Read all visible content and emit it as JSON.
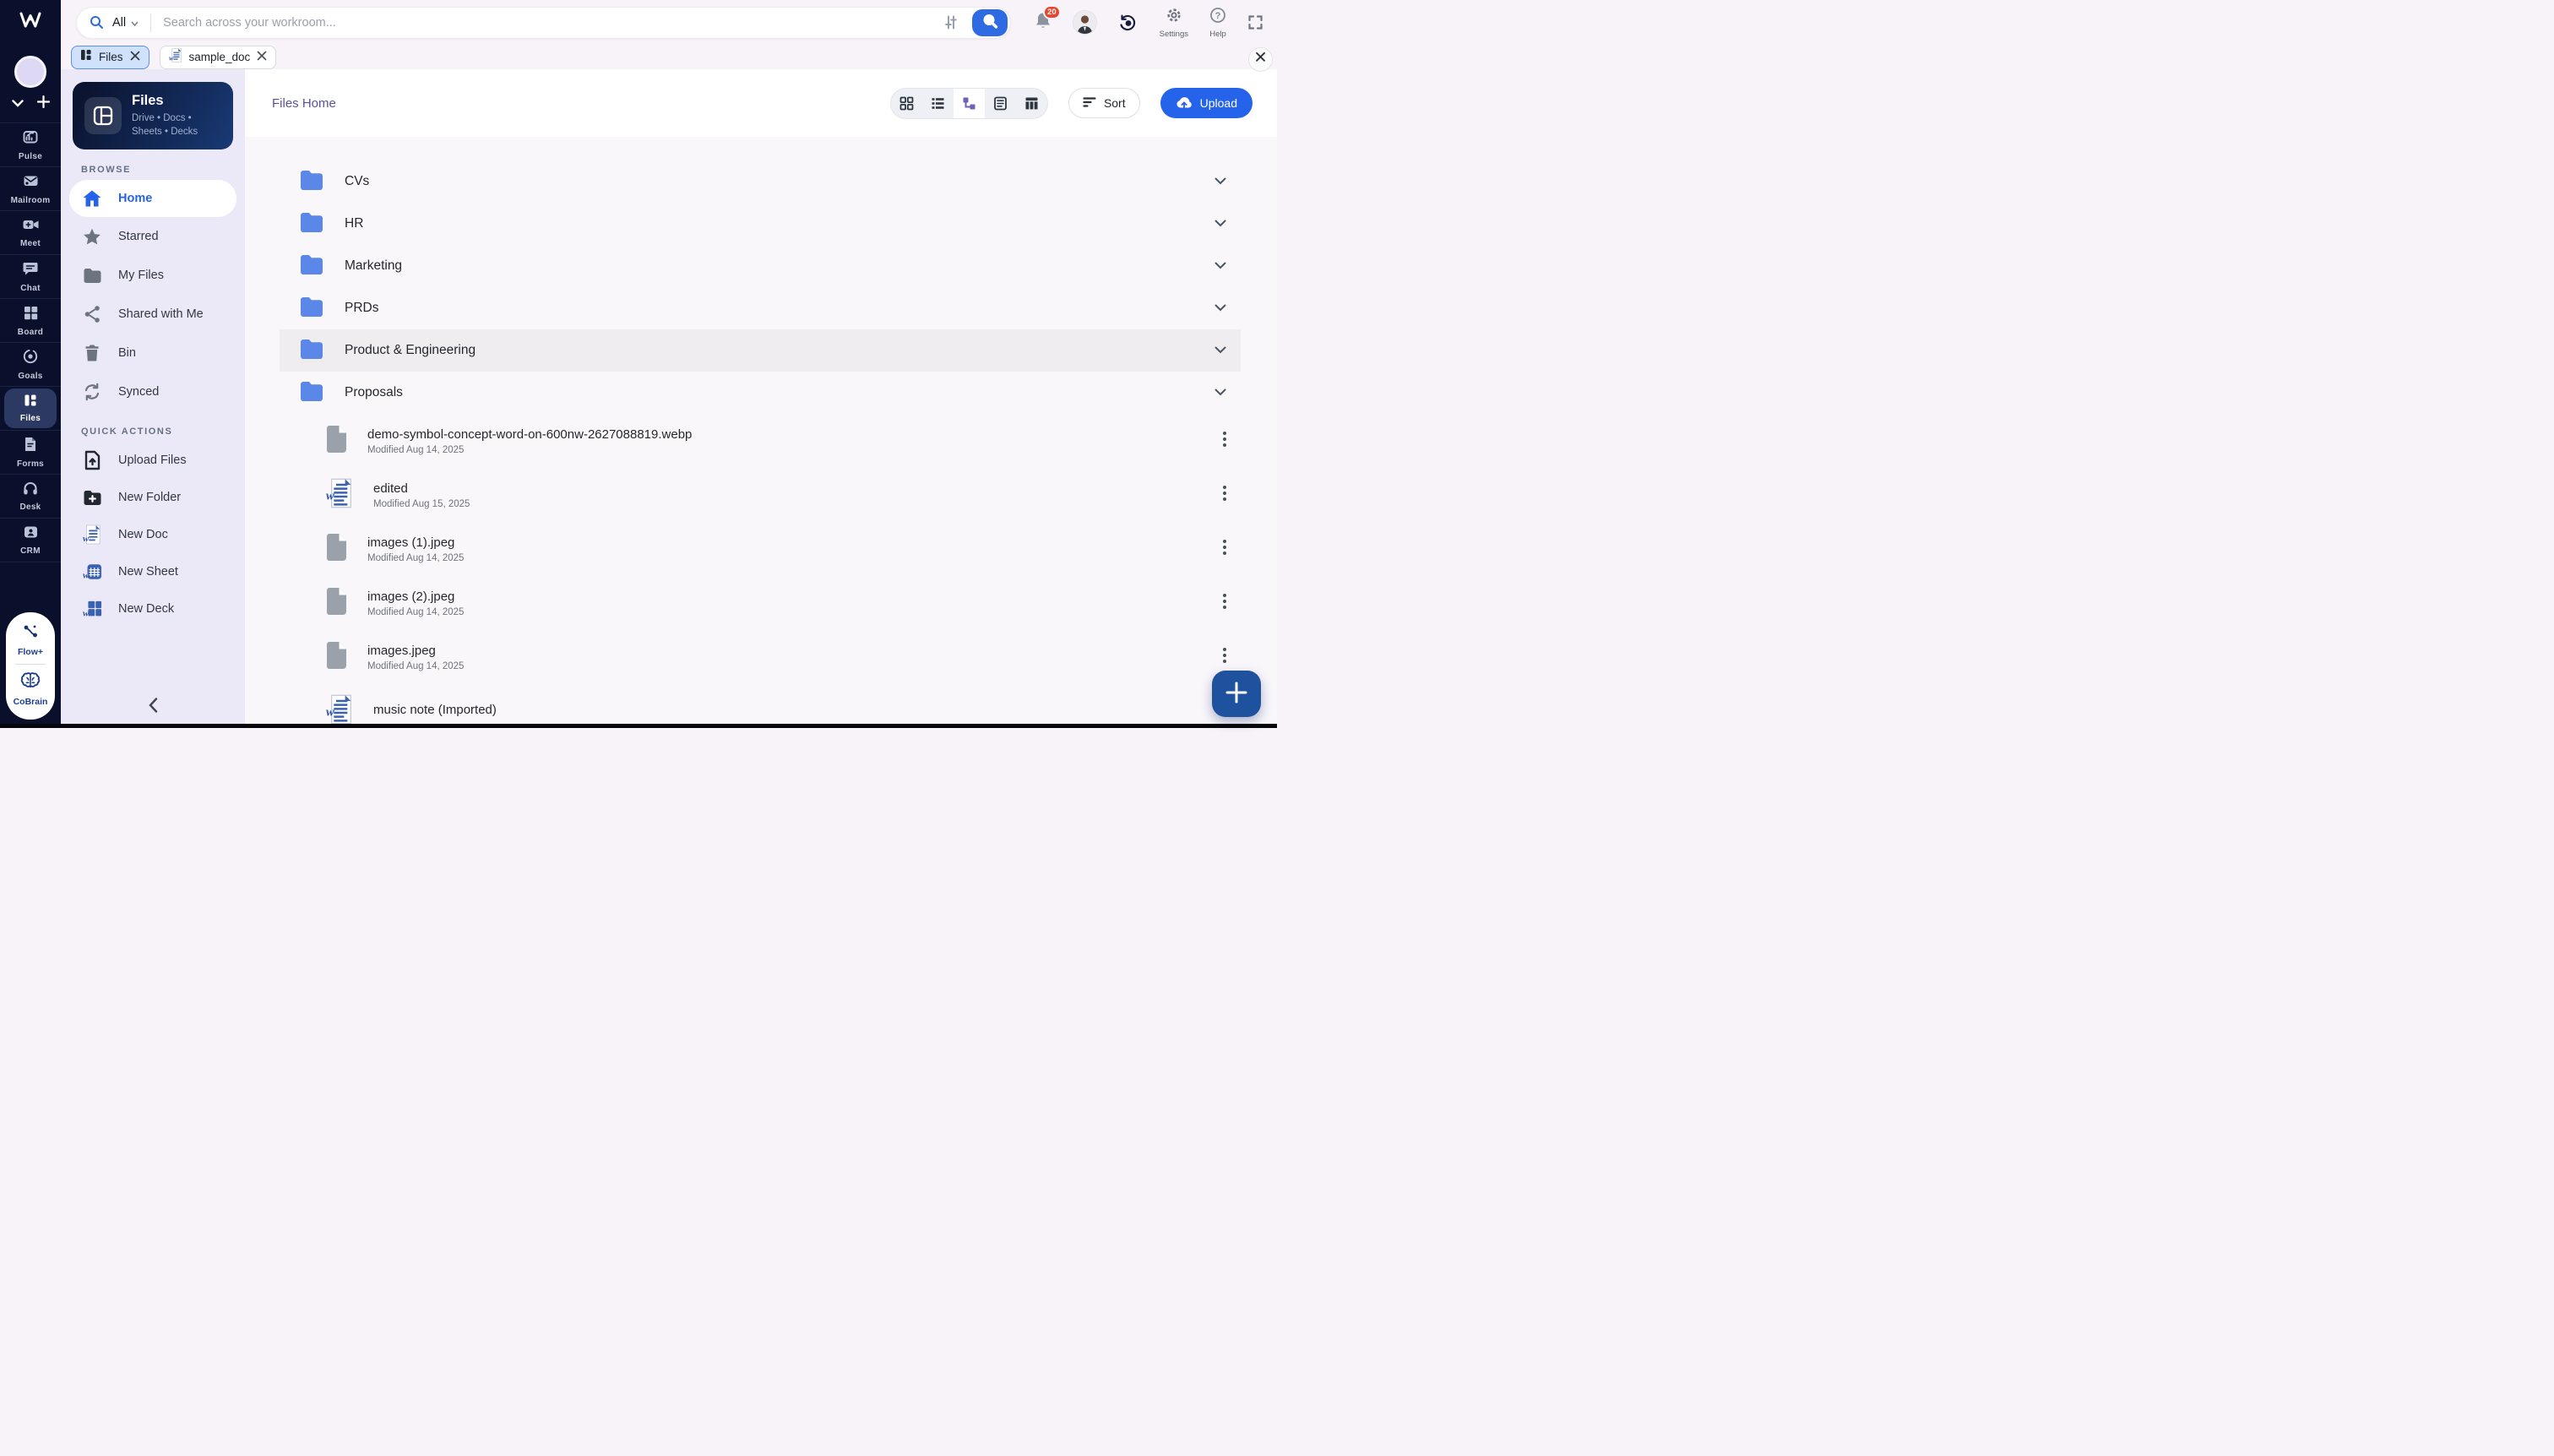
{
  "topbar": {
    "scope": "All",
    "placeholder": "Search across your workroom...",
    "notification_count": "20",
    "settings_label": "Settings",
    "help_label": "Help"
  },
  "tabs": [
    {
      "label": "Files"
    },
    {
      "label": "sample_doc"
    }
  ],
  "rail": {
    "items": [
      {
        "label": "Pulse"
      },
      {
        "label": "Mailroom"
      },
      {
        "label": "Meet"
      },
      {
        "label": "Chat"
      },
      {
        "label": "Board"
      },
      {
        "label": "Goals"
      },
      {
        "label": "Files"
      },
      {
        "label": "Forms"
      },
      {
        "label": "Desk"
      },
      {
        "label": "CRM"
      }
    ],
    "footer": [
      {
        "label": "Flow+"
      },
      {
        "label": "CoBrain"
      }
    ]
  },
  "sidebar": {
    "card": {
      "title": "Files",
      "subtitle": "Drive • Docs • Sheets • Decks"
    },
    "browse_label": "BROWSE",
    "browse": [
      {
        "label": "Home",
        "active": true
      },
      {
        "label": "Starred"
      },
      {
        "label": "My Files"
      },
      {
        "label": "Shared with Me"
      },
      {
        "label": "Bin"
      },
      {
        "label": "Synced"
      }
    ],
    "quick_label": "QUICK ACTIONS",
    "quick": [
      {
        "label": "Upload Files"
      },
      {
        "label": "New Folder"
      },
      {
        "label": "New Doc"
      },
      {
        "label": "New Sheet"
      },
      {
        "label": "New Deck"
      }
    ]
  },
  "content": {
    "title": "Files Home",
    "sort_label": "Sort",
    "upload_label": "Upload",
    "folders": [
      {
        "name": "CVs"
      },
      {
        "name": "HR"
      },
      {
        "name": "Marketing"
      },
      {
        "name": "PRDs"
      },
      {
        "name": "Product & Engineering",
        "highlighted": true
      },
      {
        "name": "Proposals"
      }
    ],
    "files": [
      {
        "name": "demo-symbol-concept-word-on-600nw-2627088819.webp",
        "modified": "Modified Aug 14, 2025",
        "type": "generic"
      },
      {
        "name": "edited",
        "modified": "Modified Aug 15, 2025",
        "type": "doc"
      },
      {
        "name": "images (1).jpeg",
        "modified": "Modified Aug 14, 2025",
        "type": "generic"
      },
      {
        "name": "images (2).jpeg",
        "modified": "Modified Aug 14, 2025",
        "type": "generic"
      },
      {
        "name": "images.jpeg",
        "modified": "Modified Aug 14, 2025",
        "type": "generic"
      },
      {
        "name": "music note (Imported)",
        "type": "doc"
      }
    ]
  },
  "colors": {
    "accent_blue": "#2563eb",
    "folder_blue": "#5b87e8",
    "fab_blue": "#1f529e",
    "badge_red": "#e8442e",
    "title_purple": "#5a529e",
    "rail_navy": "#0a102b",
    "sidebar_lavender": "#ebe9f8",
    "tab_active_bg": "#cfe1fb"
  }
}
